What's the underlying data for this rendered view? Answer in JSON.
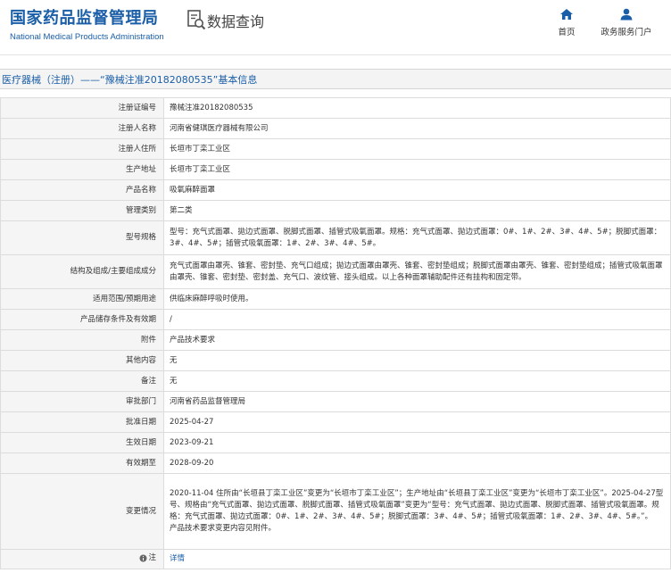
{
  "header": {
    "logo_cn": "国家药品监督管理局",
    "logo_en": "National Medical Products Administration",
    "query_label": "数据查询",
    "nav": [
      {
        "label": "首页",
        "icon": "home-icon"
      },
      {
        "label": "政务服务门户",
        "icon": "user-icon"
      }
    ]
  },
  "page_title": "医疗器械（注册）——“豫械注准20182080535”基本信息",
  "colors": {
    "brand": "#1a5ea8",
    "label_bg": "#f5f5f5",
    "border": "#dcdcdc"
  },
  "rows": [
    {
      "label": "注册证编号",
      "value": "豫械注准20182080535"
    },
    {
      "label": "注册人名称",
      "value": "河南省健琪医疗器械有限公司"
    },
    {
      "label": "注册人住所",
      "value": "长垣市丁栾工业区"
    },
    {
      "label": "生产地址",
      "value": "长垣市丁栾工业区"
    },
    {
      "label": "产品名称",
      "value": "吸氧麻醉面罩"
    },
    {
      "label": "管理类别",
      "value": "第二类"
    },
    {
      "label": "型号规格",
      "value": "型号：充气式面罩、拋边式面罩、脱脚式面罩、插管式吸氧面罩。规格：充气式面罩、拋边式面罩：0#、1#、2#、3#、4#、5#；脱脚式面罩：3#、4#、5#；插管式吸氧面罩：1#、2#、3#、4#、5#。"
    },
    {
      "label": "结构及组成/主要组成成分",
      "value": "充气式面罩由罩壳、锥套、密封垫、充气口组成；拋边式面罩由罩壳、锥套、密封垫组成；脱脚式面罩由罩壳、锥套、密封垫组成；插管式吸氧面罩由罩壳、锥套、密封垫、密封盖、充气口、波纹管、接头组成。以上各种面罩辅助配件还有挂构和固定带。"
    },
    {
      "label": "适用范围/预期用途",
      "value": "供临床麻醉呼吸时使用。"
    },
    {
      "label": "产品储存条件及有效期",
      "value": "/"
    },
    {
      "label": "附件",
      "value": "产品技术要求"
    },
    {
      "label": "其他内容",
      "value": "无"
    },
    {
      "label": "备注",
      "value": "无"
    },
    {
      "label": "审批部门",
      "value": "河南省药品监督管理局"
    },
    {
      "label": "批准日期",
      "value": "2025-04-27"
    },
    {
      "label": "生效日期",
      "value": "2023-09-21"
    },
    {
      "label": "有效期至",
      "value": "2028-09-20"
    },
    {
      "label": "变更情况",
      "value": "2020-11-04 住所由“长垣县丁栾工业区”变更为“长垣市丁栾工业区”；生产地址由“长垣县丁栾工业区”变更为“长垣市丁栾工业区”。2025-04-27型号、规格由“充气式面罩、拋边式面罩、脱脚式面罩、插管式吸氧面罩”变更为“型号：充气式面罩、拋边式面罩、脱脚式面罩、插管式吸氧面罩。规格：充气式面罩、拋边式面罩：0#、1#、2#、3#、4#、5#；脱脚式面罩：3#、4#、5#；插管式吸氧面罩：1#、2#、3#、4#、5#。”。\n产品技术要求变更内容见附件。"
    }
  ],
  "note": {
    "label": "注",
    "link": "详情",
    "icon": "info-icon"
  }
}
